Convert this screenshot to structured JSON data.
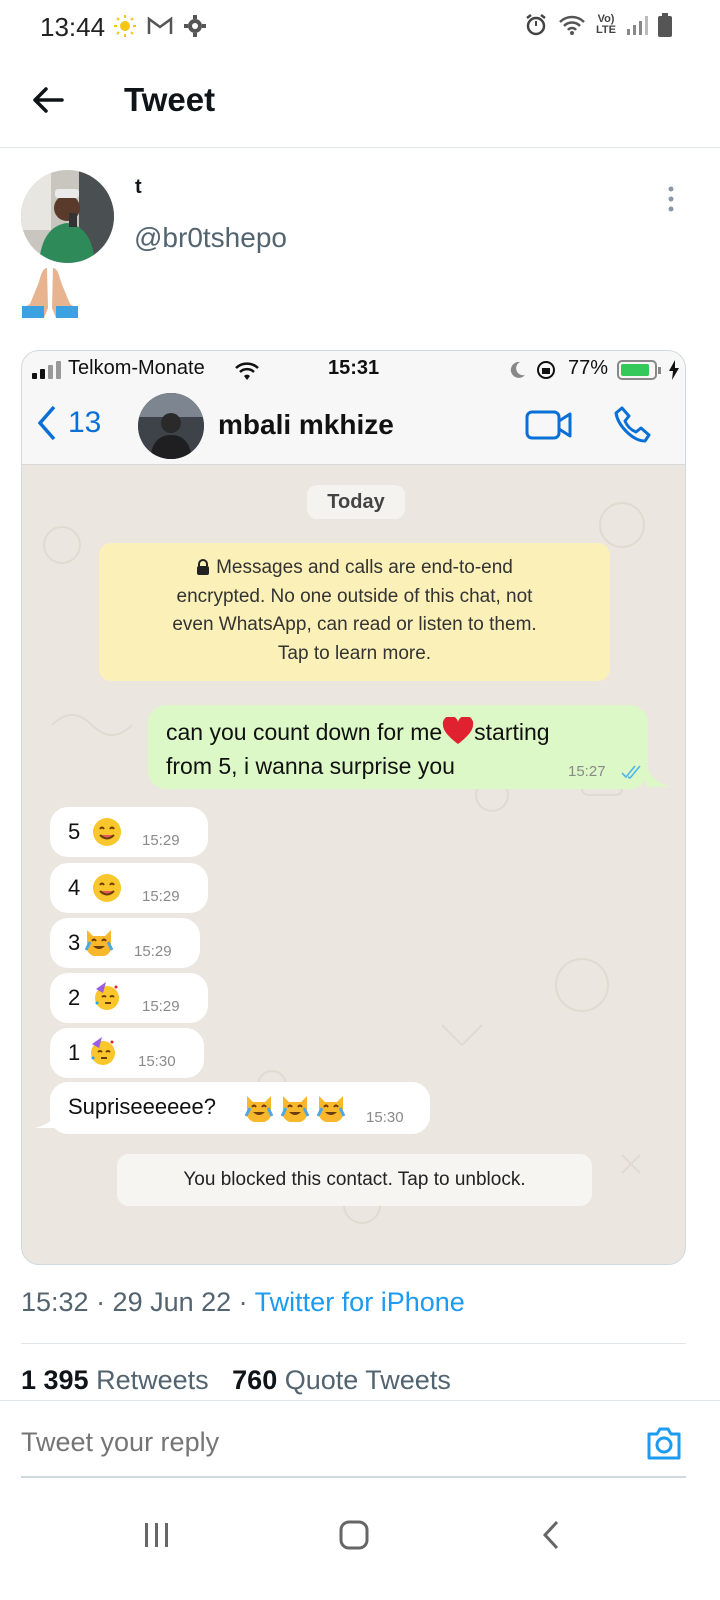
{
  "status_bar": {
    "time": "13:44"
  },
  "header": {
    "title": "Tweet"
  },
  "tweet": {
    "author_name": "t",
    "handle": "@br0tshepo",
    "timestamp": "15:32 · 29 Jun 22 · ",
    "source": "Twitter for iPhone",
    "retweets_count": "1 395",
    "retweets_label": " Retweets",
    "quote_count": "760",
    "quote_label": " Quote Tweets"
  },
  "embed": {
    "ios_status": {
      "carrier": "Telkom-Monate",
      "time": "15:31",
      "battery": "77%"
    },
    "chat_header": {
      "back_count": "13",
      "contact_name": "mbali mkhize"
    },
    "date_chip": "Today",
    "encryption_notice": [
      "Messages and calls are end-to-end",
      "encrypted. No one outside of this chat, not",
      "even WhatsApp, can read or listen to them.",
      "Tap to learn more."
    ],
    "messages": [
      {
        "direction": "out",
        "text_1": "can you count down for me",
        "text_2": "starting",
        "text_3": "from 5, i wanna surprise you",
        "time": "15:27"
      },
      {
        "direction": "in",
        "text": "5",
        "time": "15:29"
      },
      {
        "direction": "in",
        "text": "4",
        "time": "15:29"
      },
      {
        "direction": "in",
        "text": "3",
        "time": "15:29"
      },
      {
        "direction": "in",
        "text": "2",
        "time": "15:29"
      },
      {
        "direction": "in",
        "text": "1",
        "time": "15:30"
      },
      {
        "direction": "in",
        "text": "Supriseeeeee?",
        "time": "15:30"
      }
    ],
    "blocked_notice": "You blocked this contact. Tap to unblock."
  },
  "reply": {
    "placeholder": "Tweet your reply"
  },
  "colors": {
    "link": "#1d9bf0",
    "outgoing_bubble": "#dcf8c6",
    "encryption_note": "#fbf0b8"
  }
}
